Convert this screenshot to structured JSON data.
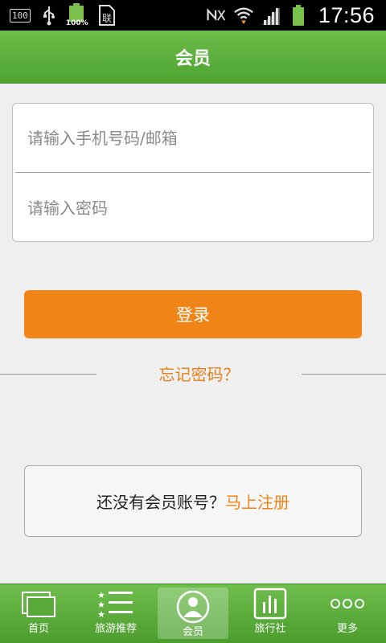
{
  "status_bar": {
    "box_label": "100",
    "battery_small_label": "100%",
    "time": "17:56"
  },
  "header": {
    "title": "会员"
  },
  "login_form": {
    "phone_placeholder": "请输入手机号码/邮箱",
    "password_placeholder": "请输入密码",
    "login_button": "登录",
    "forgot_password": "忘记密码？"
  },
  "register": {
    "prompt": "还没有会员账号？",
    "link": "马上注册"
  },
  "tabs": [
    {
      "label": "首页",
      "icon": "home-windows-icon",
      "active": false
    },
    {
      "label": "旅游推荐",
      "icon": "star-list-icon",
      "active": false
    },
    {
      "label": "会员",
      "icon": "user-icon",
      "active": true
    },
    {
      "label": "旅行社",
      "icon": "bar-chart-icon",
      "active": false
    },
    {
      "label": "更多",
      "icon": "more-dots-icon",
      "active": false
    }
  ],
  "colors": {
    "header_green": "#5ab13d",
    "accent_orange": "#f08417",
    "background": "#efefef"
  }
}
